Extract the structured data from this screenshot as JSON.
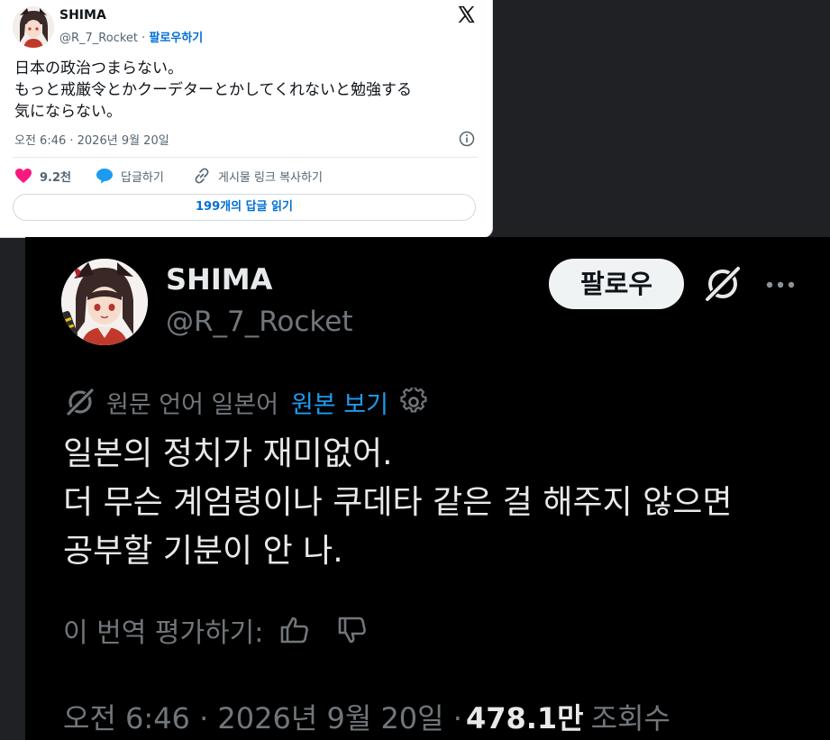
{
  "embed": {
    "name": "SHIMA",
    "handle": "@R_7_Rocket",
    "separator": "·",
    "follow_label": "팔로우하기",
    "text_lines": [
      "日本の政治つまらない。",
      "もっと戒厳令とかクーデターとかしてくれないと勉強する",
      "気にならない。"
    ],
    "timestamp": "오전 6:46 · 2026년 9월 20일",
    "likes": "9.2천",
    "reply_label": "답글하기",
    "copy_link_label": "게시물 링크 복사하기",
    "read_replies_label": "199개의 답글 읽기",
    "colors": {
      "like": "#f91880",
      "reply": "#1d9bf0",
      "link": "#006fd6"
    }
  },
  "post": {
    "name": "SHIMA",
    "handle": "@R_7_Rocket",
    "follow_label": "팔로우",
    "translation": {
      "label": "원문 언어 일본어",
      "view_original": "원본 보기"
    },
    "body_lines": [
      "일본의 정치가 재미없어.",
      "더 무슨 계엄령이나 쿠데타 같은 걸 해주지 않으면",
      "공부할 기분이 안 나."
    ],
    "rate_label": "이 번역 평가하기:",
    "meta": {
      "time_date": "오전 6:46 · 2026년 9월 20일 ·",
      "views": "478.1만",
      "views_label": "조회수"
    }
  },
  "icons": {
    "x_logo": "x-logo-icon",
    "info": "info-icon",
    "heart": "heart-icon",
    "reply": "reply-bubble-icon",
    "link": "link-icon",
    "grok": "grok-icon",
    "more": "more-dots-icon",
    "gear": "gear-icon",
    "thumb_up": "thumbs-up-icon",
    "thumb_down": "thumbs-down-icon"
  }
}
